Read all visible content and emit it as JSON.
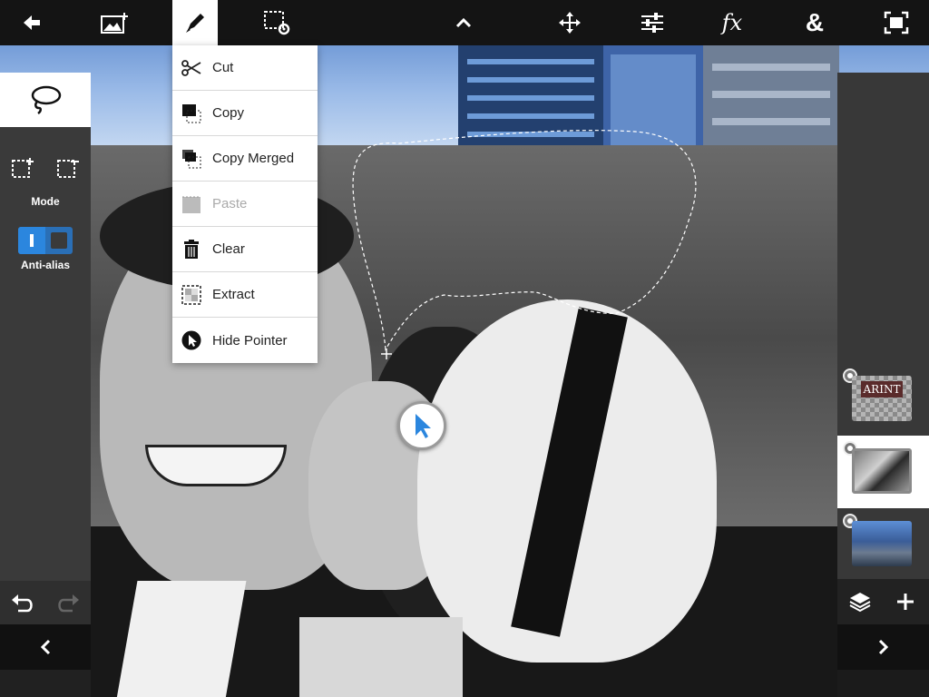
{
  "toolbar": {
    "back_icon": "back-arrow-icon",
    "add_image_icon": "add-image-icon",
    "brush_icon": "brush-icon",
    "selection_settings_icon": "selection-settings-icon",
    "collapse_icon": "chevron-up-icon",
    "move_icon": "move-icon",
    "adjust_icon": "sliders-icon",
    "fx_label": "fx",
    "blend_label": "&",
    "fullscreen_icon": "fullscreen-icon"
  },
  "edit_menu": {
    "items": [
      {
        "label": "Cut",
        "icon": "scissors-icon",
        "enabled": true
      },
      {
        "label": "Copy",
        "icon": "copy-icon",
        "enabled": true
      },
      {
        "label": "Copy Merged",
        "icon": "copy-merged-icon",
        "enabled": true
      },
      {
        "label": "Paste",
        "icon": "paste-icon",
        "enabled": false
      },
      {
        "label": "Clear",
        "icon": "trash-icon",
        "enabled": true
      },
      {
        "label": "Extract",
        "icon": "extract-icon",
        "enabled": true
      },
      {
        "label": "Hide Pointer",
        "icon": "pointer-icon",
        "enabled": true
      }
    ]
  },
  "left_panel": {
    "active_tool_icon": "lasso-icon",
    "mode_label": "Mode",
    "antialias_label": "Anti-alias",
    "antialias_on": true
  },
  "layers": [
    {
      "name": "text-logo-layer",
      "thumb_text": "ARINT",
      "selected": false
    },
    {
      "name": "photo-layer",
      "selected": true
    },
    {
      "name": "city-layer",
      "selected": false
    }
  ],
  "colors": {
    "accent": "#2b86de",
    "panel_bg": "#3a3a3a",
    "toolbar_bg": "#141414",
    "menu_bg": "#ffffff"
  }
}
